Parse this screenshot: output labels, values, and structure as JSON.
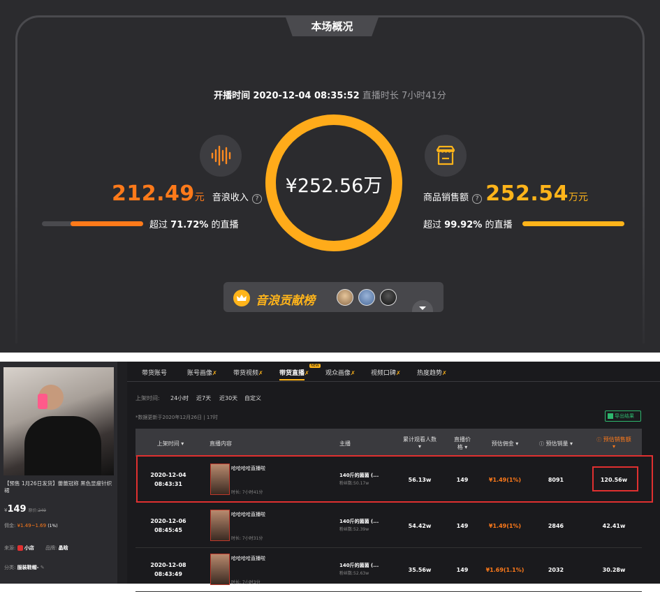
{
  "overview": {
    "title": "本场概况",
    "start_label": "开播时间",
    "start_time": "2020-12-04 08:35:52",
    "duration_label": "直播时长",
    "duration": "7小时41分",
    "center_value": "¥252.56万",
    "left": {
      "value": "212.49",
      "unit": "元",
      "label": "音浪收入",
      "exceed_prefix": "超过",
      "exceed_pct": "71.72%",
      "exceed_suffix": "的直播",
      "progress": 0.7172
    },
    "right": {
      "label": "商品销售额",
      "value": "252.54",
      "unit": "万元",
      "exceed_prefix": "超过",
      "exceed_pct": "99.92%",
      "exceed_suffix": "的直播",
      "progress": 0.9992
    },
    "rank_label": "音浪贡献榜",
    "colors": {
      "orange": "#ff7a1a",
      "yellow": "#ffb41a",
      "bg": "#2b2b2e"
    }
  },
  "tabs": [
    "带货账号",
    "账号画像",
    "带货视频",
    "带货直播",
    "观众画像",
    "视频口碑",
    "热度趋势"
  ],
  "active_tab": "带货直播",
  "new_badge": "NEW",
  "filters": {
    "label": "上架时间:",
    "options": [
      "24小时",
      "近7天",
      "近30天",
      "自定义"
    ]
  },
  "updated_note": "*数据更新于2020年12月26日 | 17时",
  "export_label": "导出结果",
  "product": {
    "title": "【预售 1月26日发货】蕾蕾冠称 黑色显瘦针织裙",
    "price": "149",
    "orig_price_label": "原价:",
    "orig_price": "249",
    "commission_label": "佣金:",
    "commission": "¥1.49~1.69",
    "commission_pct": "(1%)",
    "source_label": "来源:",
    "source": "小店",
    "brand_label": "品牌:",
    "brand": "晶晗",
    "category_label": "分类:",
    "category": "服装鞋帽-"
  },
  "table": {
    "headers": [
      "上架时间",
      "直播内容",
      "主播",
      "累计观看人数",
      "直播价格",
      "预估佣金",
      "预估销量",
      "预估销售额"
    ],
    "rows": [
      {
        "date": "2020-12-04",
        "time": "08:43:31",
        "content": "哈哈哈哈直播啦",
        "duration": "时长: 7小时41分",
        "host": "140斤的菌菌 (...",
        "fans": "粉丝数:50.17w",
        "viewers": "56.13w",
        "price": "149",
        "commission": "¥1.49(1%)",
        "sales": "8091",
        "revenue": "120.56w"
      },
      {
        "date": "2020-12-06",
        "time": "08:45:45",
        "content": "哈哈哈哈直播啦",
        "duration": "时长: 7小时31分",
        "host": "140斤的菌菌 (...",
        "fans": "粉丝数:52.39w",
        "viewers": "54.42w",
        "price": "149",
        "commission": "¥1.49(1%)",
        "sales": "2846",
        "revenue": "42.41w"
      },
      {
        "date": "2020-12-08",
        "time": "08:43:49",
        "content": "哈哈哈哈直播啦",
        "duration": "时长: 7小时3分",
        "host": "140斤的菌菌 (...",
        "fans": "粉丝数:52.63w",
        "viewers": "35.56w",
        "price": "149",
        "commission": "¥1.69(1.1%)",
        "sales": "2032",
        "revenue": "30.28w"
      }
    ]
  }
}
